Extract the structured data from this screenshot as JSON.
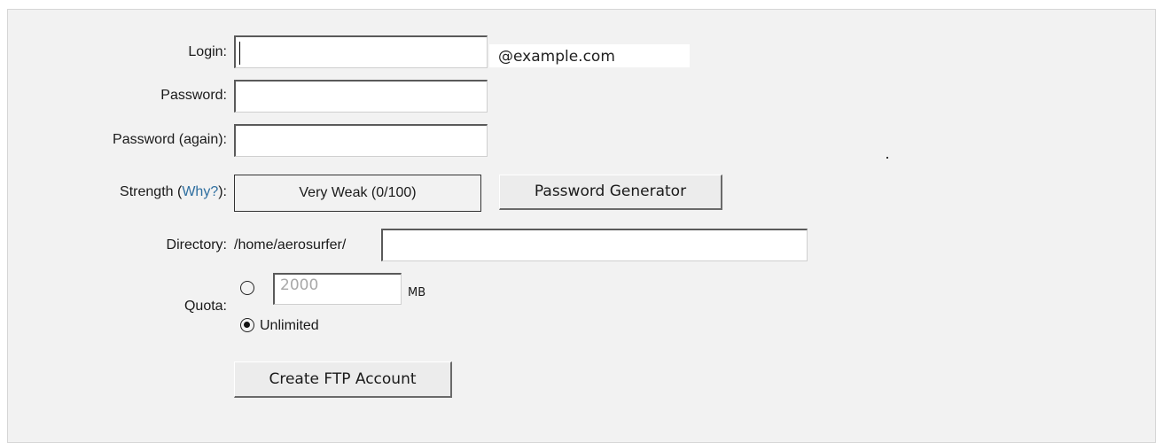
{
  "form": {
    "login_label": "Login:",
    "login_value": "",
    "login_domain": "@example.com",
    "password_label": "Password:",
    "password_value": "",
    "password_again_label": "Password (again):",
    "password_again_value": "",
    "strength_label_prefix": "Strength (",
    "strength_why_link": "Why?",
    "strength_label_suffix": "):",
    "strength_value": "Very Weak (0/100)",
    "password_generator_button": "Password Generator",
    "directory_label": "Directory:",
    "directory_prefix": "/home/aerosurfer/",
    "directory_value": "",
    "quota_label": "Quota:",
    "quota_value": "2000",
    "quota_unit": "MB",
    "quota_unlimited_label": "Unlimited",
    "quota_selected": "unlimited",
    "create_button": "Create FTP Account"
  },
  "colors": {
    "panel_background": "#f2f2f2",
    "link": "#2f6fa0"
  }
}
